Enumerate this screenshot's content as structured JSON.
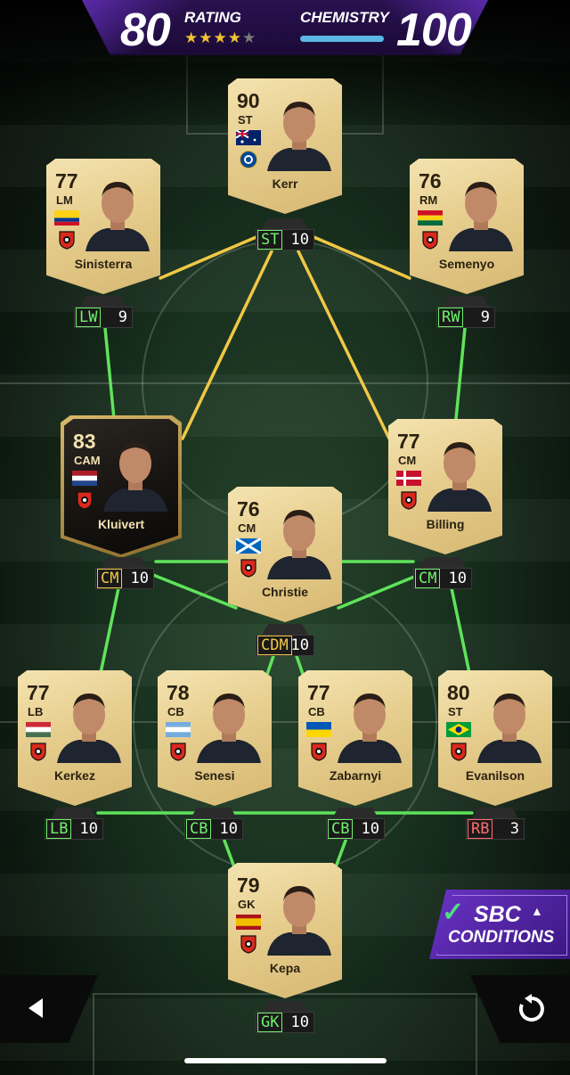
{
  "header": {
    "rating_value": "80",
    "rating_label": "RATING",
    "stars": 3.5,
    "chemistry_label": "CHEMISTRY",
    "chemistry_value": "100",
    "chemistry_fraction": 1.0
  },
  "players": [
    {
      "key": "st",
      "name": "Kerr",
      "rating": "90",
      "position": "ST",
      "flag": "australia",
      "club": "chelsea-badge",
      "chem_pos": "ST",
      "chem_val": "10",
      "chem_color": "green"
    },
    {
      "key": "lm",
      "name": "Sinisterra",
      "rating": "77",
      "position": "LM",
      "flag": "colombia",
      "club": "bournemouth-badge",
      "chem_pos": "LW",
      "chem_val": "9",
      "chem_color": "green"
    },
    {
      "key": "rm",
      "name": "Semenyo",
      "rating": "76",
      "position": "RM",
      "flag": "ghana",
      "club": "bournemouth-badge",
      "chem_pos": "RW",
      "chem_val": "9",
      "chem_color": "green"
    },
    {
      "key": "cam",
      "name": "Kluivert",
      "rating": "83",
      "position": "CAM",
      "flag": "netherlands",
      "club": "bournemouth-badge",
      "chem_pos": "CM",
      "chem_val": "10",
      "chem_color": "yellow"
    },
    {
      "key": "cm",
      "name": "Billing",
      "rating": "77",
      "position": "CM",
      "flag": "denmark",
      "club": "bournemouth-badge",
      "chem_pos": "CM",
      "chem_val": "10",
      "chem_color": "green"
    },
    {
      "key": "cdm",
      "name": "Christie",
      "rating": "76",
      "position": "CM",
      "flag": "scotland",
      "club": "bournemouth-badge",
      "chem_pos": "CDM",
      "chem_val": "10",
      "chem_color": "yellow"
    },
    {
      "key": "lb",
      "name": "Kerkez",
      "rating": "77",
      "position": "LB",
      "flag": "hungary",
      "club": "bournemouth-badge",
      "chem_pos": "LB",
      "chem_val": "10",
      "chem_color": "green"
    },
    {
      "key": "cb1",
      "name": "Senesi",
      "rating": "78",
      "position": "CB",
      "flag": "argentina",
      "club": "bournemouth-badge",
      "chem_pos": "CB",
      "chem_val": "10",
      "chem_color": "green"
    },
    {
      "key": "cb2",
      "name": "Zabarnyi",
      "rating": "77",
      "position": "CB",
      "flag": "ukraine",
      "club": "bournemouth-badge",
      "chem_pos": "CB",
      "chem_val": "10",
      "chem_color": "green"
    },
    {
      "key": "rb",
      "name": "Evanilson",
      "rating": "80",
      "position": "ST",
      "flag": "brazil",
      "club": "bournemouth-badge",
      "chem_pos": "RB",
      "chem_val": "3",
      "chem_color": "red"
    },
    {
      "key": "gk",
      "name": "Kepa",
      "rating": "79",
      "position": "GK",
      "flag": "spain",
      "club": "bournemouth-badge",
      "chem_pos": "GK",
      "chem_val": "10",
      "chem_color": "green"
    }
  ],
  "sbc": {
    "line1": "SBC",
    "line2": "CONDITIONS"
  },
  "controls": {
    "back_icon": "play-back-icon",
    "refresh_icon": "refresh-icon"
  },
  "colors": {
    "green_link": "#5fe35a",
    "yellow_link": "#f0c845",
    "header_purple": "#2a1150",
    "chem_bar": "#5bb7e6"
  }
}
